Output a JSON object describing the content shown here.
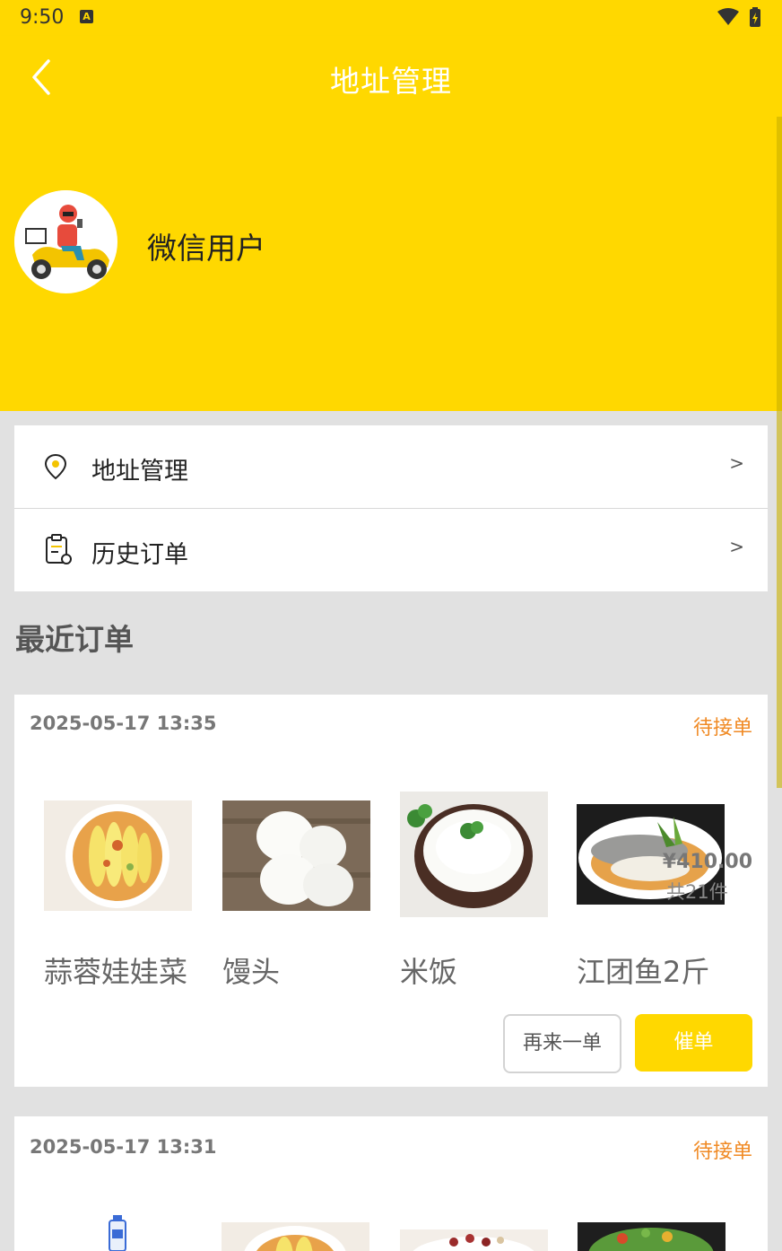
{
  "status_bar": {
    "time": "9:50",
    "notif_badge": "A"
  },
  "appbar": {
    "title": "地址管理"
  },
  "profile": {
    "username": "微信用户"
  },
  "menu": [
    {
      "label": "地址管理",
      "arrow": ">",
      "icon": "location-pin-icon"
    },
    {
      "label": "历史订单",
      "arrow": ">",
      "icon": "order-clipboard-icon"
    }
  ],
  "recent": {
    "title": "最近订单"
  },
  "orders": [
    {
      "time": "2025-05-17 13:35",
      "status": "待接单",
      "price": "¥410.00",
      "count": "共21件",
      "dishes": [
        {
          "name": "蒜蓉娃娃菜"
        },
        {
          "name": "馒头"
        },
        {
          "name": "米饭"
        },
        {
          "name": "江团鱼2斤"
        }
      ],
      "buttons": {
        "again": "再来一单",
        "urge": "催单"
      }
    },
    {
      "time": "2025-05-17 13:31",
      "status": "待接单"
    }
  ],
  "colors": {
    "brand": "#ffd800",
    "status": "#f08a24"
  }
}
